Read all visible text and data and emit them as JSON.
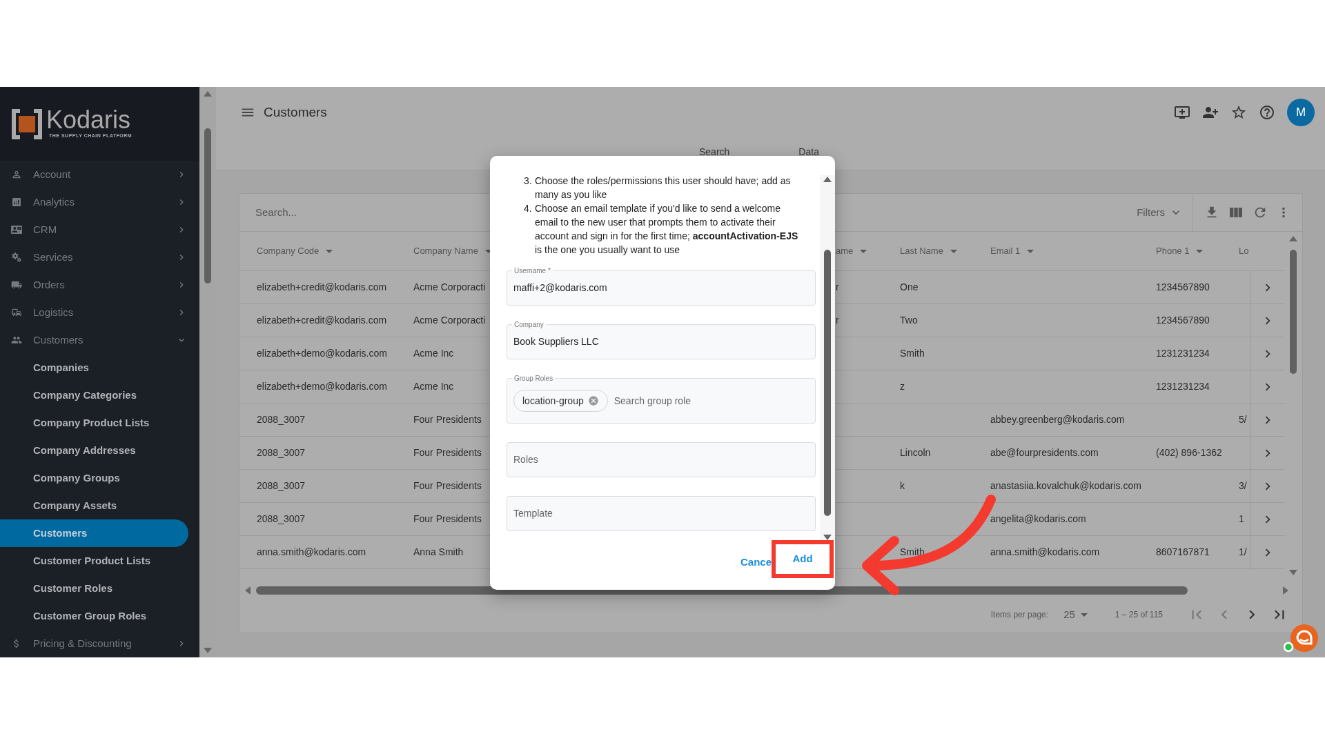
{
  "sidebar": {
    "logo": {
      "name": "Kodaris",
      "tagline": "THE SUPPLY CHAIN PLATFORM"
    },
    "items": [
      {
        "label": "Account",
        "expanded": false
      },
      {
        "label": "Analytics",
        "expanded": false
      },
      {
        "label": "CRM",
        "expanded": false
      },
      {
        "label": "Services",
        "expanded": false
      },
      {
        "label": "Orders",
        "expanded": false
      },
      {
        "label": "Logistics",
        "expanded": false
      },
      {
        "label": "Customers",
        "expanded": true,
        "children": [
          {
            "label": "Companies",
            "selected": false
          },
          {
            "label": "Company Categories",
            "selected": false
          },
          {
            "label": "Company Product Lists",
            "selected": false
          },
          {
            "label": "Company Addresses",
            "selected": false
          },
          {
            "label": "Company Groups",
            "selected": false
          },
          {
            "label": "Company Assets",
            "selected": false
          },
          {
            "label": "Customers",
            "selected": true
          },
          {
            "label": "Customer Product Lists",
            "selected": false
          },
          {
            "label": "Customer Roles",
            "selected": false
          },
          {
            "label": "Customer Group Roles",
            "selected": false
          }
        ]
      },
      {
        "label": "Pricing & Discounting",
        "expanded": false
      }
    ]
  },
  "header": {
    "title": "Customers",
    "avatar": "M"
  },
  "tabs": [
    {
      "label": "Search"
    },
    {
      "label": "Data"
    }
  ],
  "table": {
    "search_placeholder": "Search...",
    "filters": "Filters",
    "columns": [
      {
        "label": "Company Code",
        "sortable": true
      },
      {
        "label": "Company Name",
        "sortable": true
      },
      {
        "label": "ame",
        "sortable": true
      },
      {
        "label": "Last Name",
        "sortable": true
      },
      {
        "label": "Email 1",
        "sortable": true
      },
      {
        "label": "Phone 1",
        "sortable": true
      },
      {
        "label": "Lo",
        "sortable": false
      }
    ],
    "rows": [
      {
        "company_code": "elizabeth+credit@kodaris.com",
        "company_name": "Acme Corporacti",
        "column_3": "r",
        "last_name": "One",
        "phone_1": "1234567890"
      },
      {
        "company_code": "elizabeth+credit@kodaris.com",
        "company_name": "Acme Corporacti",
        "column_3": "r",
        "last_name": "Two",
        "phone_1": "1234567890"
      },
      {
        "company_code": "elizabeth+demo@kodaris.com",
        "company_name": "Acme Inc",
        "last_name": "Smith",
        "phone_1": "1231231234"
      },
      {
        "company_code": "elizabeth+demo@kodaris.com",
        "company_name": "Acme Inc",
        "last_name": "z",
        "phone_1": "1231231234"
      },
      {
        "company_code": "2088_3007",
        "company_name": "Four Presidents",
        "email_1": "abbey.greenberg@kodaris.com",
        "column_7": "5/"
      },
      {
        "company_code": "2088_3007",
        "company_name": "Four Presidents",
        "last_name": "Lincoln",
        "email_1": "abe@fourpresidents.com",
        "phone_1": "(402) 896-1362"
      },
      {
        "company_code": "2088_3007",
        "company_name": "Four Presidents",
        "last_name": "k",
        "email_1": "anastasiia.kovalchuk@kodaris.com",
        "column_7": "3/"
      },
      {
        "company_code": "2088_3007",
        "company_name": "Four Presidents",
        "email_1": "angelita@kodaris.com",
        "column_7": "1"
      },
      {
        "company_code": "anna.smith@kodaris.com",
        "company_name": "Anna Smith",
        "last_name": "Smith",
        "email_1": "anna.smith@kodaris.com",
        "phone_1": "8607167871",
        "column_7": "1/"
      }
    ]
  },
  "pagination": {
    "items_per_page_label": "Items per page:",
    "page_size": "25",
    "range": "1 – 25 of 115"
  },
  "dialog": {
    "steps": [
      {
        "number": "3.",
        "text": "Choose the roles/permissions this user should have; add as many as you like"
      },
      {
        "number": "4.",
        "text": "Choose an email template if you'd like to send a welcome email to the new user that prompts them to activate their account and sign in for the first time; **accountActivation-EJS** is the one you usually want to use"
      }
    ],
    "fields": [
      {
        "kind": "text",
        "label": "Username *",
        "value": "maffi+2@kodaris.com"
      },
      {
        "kind": "text",
        "label": "Company",
        "value": "Book Suppliers LLC"
      },
      {
        "kind": "chips",
        "label": "Group Roles",
        "chips": [
          "location-group"
        ],
        "placeholder": "Search group role"
      },
      {
        "kind": "select",
        "placeholder": "Roles"
      },
      {
        "kind": "select",
        "placeholder": "Template"
      }
    ],
    "buttons": [
      {
        "label": "Cance",
        "highlighted": false
      },
      {
        "label": "Add",
        "highlighted": true
      }
    ]
  }
}
